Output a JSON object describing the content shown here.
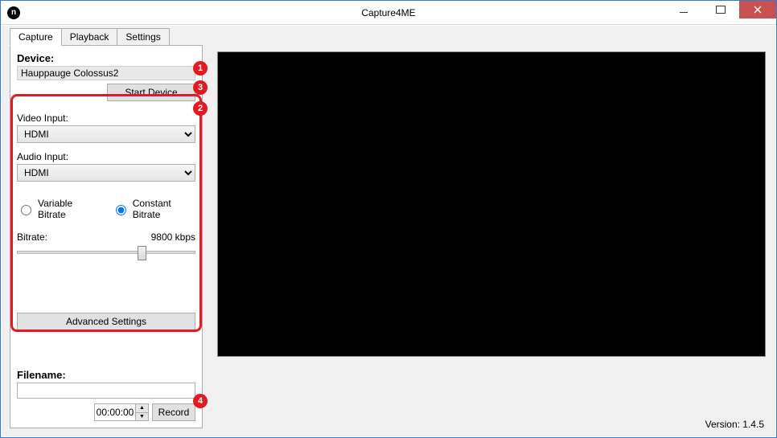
{
  "window": {
    "title": "Capture4ME"
  },
  "tabs": {
    "capture": "Capture",
    "playback": "Playback",
    "settings": "Settings"
  },
  "device": {
    "label": "Device:",
    "name": "Hauppauge Colossus2",
    "start_button": "Start Device"
  },
  "inputs": {
    "video_label": "Video Input:",
    "video_value": "HDMI",
    "audio_label": "Audio Input:",
    "audio_value": "HDMI"
  },
  "bitrate": {
    "variable_label": "Variable Bitrate",
    "constant_label": "Constant Bitrate",
    "selected": "constant",
    "label": "Bitrate:",
    "value": "9800 kbps"
  },
  "advanced_button": "Advanced Settings",
  "filename": {
    "label": "Filename:",
    "value": "",
    "duration": "00:00:00",
    "record_button": "Record"
  },
  "version_label": "Version: 1.4.5",
  "annotations": {
    "b1": "1",
    "b2": "2",
    "b3": "3",
    "b4": "4"
  }
}
